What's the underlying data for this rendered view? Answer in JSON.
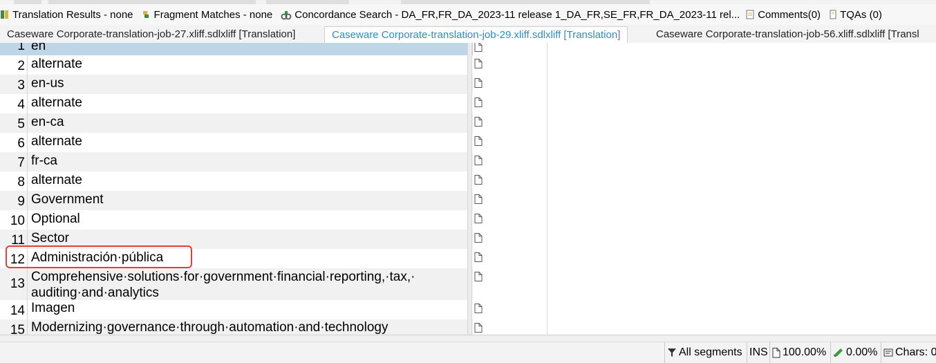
{
  "panels": [
    {
      "label": "Translation Results - none",
      "icon": "translation-results-icon"
    },
    {
      "label": "Fragment Matches - none",
      "icon": "fragment-matches-icon"
    },
    {
      "label": "Concordance Search - DA_FR,FR_DA_2023-11 release 1_DA_FR,SE_FR,FR_DA_2023-11 rel...",
      "icon": "concordance-search-icon"
    },
    {
      "label": "Comments(0)",
      "icon": "comments-icon"
    },
    {
      "label": "TQAs (0)",
      "icon": "tqa-icon"
    }
  ],
  "doc_tabs": [
    {
      "label": "Caseware Corporate-translation-job-27.xliff.sdlxliff [Translation]",
      "active": false
    },
    {
      "label": "Caseware Corporate-translation-job-29.xliff.sdlxliff [Translation]",
      "active": true
    },
    {
      "label": "Caseware Corporate-translation-job-56.xliff.sdlxliff [Transl",
      "active": false
    }
  ],
  "segments": [
    {
      "num": "1",
      "source": "en",
      "status_icon": "document-icon",
      "selected": true
    },
    {
      "num": "2",
      "source": "alternate",
      "status_icon": "document-icon"
    },
    {
      "num": "3",
      "source": "en-us",
      "status_icon": "document-icon"
    },
    {
      "num": "4",
      "source": "alternate",
      "status_icon": "document-icon"
    },
    {
      "num": "5",
      "source": "en-ca",
      "status_icon": "document-icon"
    },
    {
      "num": "6",
      "source": "alternate",
      "status_icon": "document-icon"
    },
    {
      "num": "7",
      "source": "fr-ca",
      "status_icon": "document-icon"
    },
    {
      "num": "8",
      "source": "alternate",
      "status_icon": "document-icon"
    },
    {
      "num": "9",
      "source": "Government",
      "status_icon": "document-icon"
    },
    {
      "num": "10",
      "source": "Optional",
      "status_icon": "document-icon"
    },
    {
      "num": "11",
      "source": "Sector",
      "status_icon": "document-icon"
    },
    {
      "num": "12",
      "source": "Administración·pública",
      "status_icon": "document-icon",
      "highlighted": true
    },
    {
      "num": "13",
      "source": "Comprehensive·solutions·for·government·financial·reporting,·tax,·\nauditing·and·analytics",
      "status_icon": "document-icon"
    },
    {
      "num": "14",
      "source": "Imagen",
      "status_icon": "document-icon"
    },
    {
      "num": "15",
      "source": "Modernizing·governance·through·automation·and·technology",
      "status_icon": "document-icon"
    }
  ],
  "status_bar": {
    "filter": "All segments",
    "mode": "INS",
    "progress": "100.00%",
    "confirmed": "0.00%",
    "chars": "Chars: 0",
    "filter_icon": "filter-icon",
    "progress_icon": "document-icon",
    "confirmed_icon": "pencil-check-icon",
    "chars_icon": "chars-icon"
  },
  "colors": {
    "accent": "#2a8fbd",
    "selected_row": "#bfd6e7",
    "highlight_border": "#e0403a"
  }
}
